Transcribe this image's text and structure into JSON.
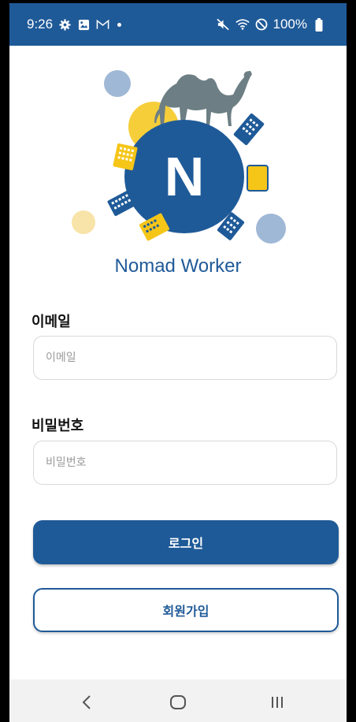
{
  "status_bar": {
    "time": "9:26",
    "battery": "100%",
    "left_icons": [
      "gear-icon",
      "image-icon",
      "mail-icon",
      "dot-icon"
    ],
    "right_icons": [
      "mute-icon",
      "wifi-icon",
      "no-signal-icon",
      "battery-icon"
    ]
  },
  "logo": {
    "letter": "N",
    "colors": {
      "primary": "#1f5a98",
      "yellow": "#f5c518",
      "light_blue": "#9fb8d6",
      "camel": "#6d7f84",
      "light_yellow": "#f8e3a8"
    }
  },
  "app": {
    "title": "Nomad Worker"
  },
  "form": {
    "email_label": "이메일",
    "email_placeholder": "이메일",
    "password_label": "비밀번호",
    "password_placeholder": "비밀번호"
  },
  "buttons": {
    "login": "로그인",
    "signup": "회원가입"
  },
  "nav": {
    "icons": [
      "back-icon",
      "home-icon",
      "recents-icon"
    ]
  }
}
